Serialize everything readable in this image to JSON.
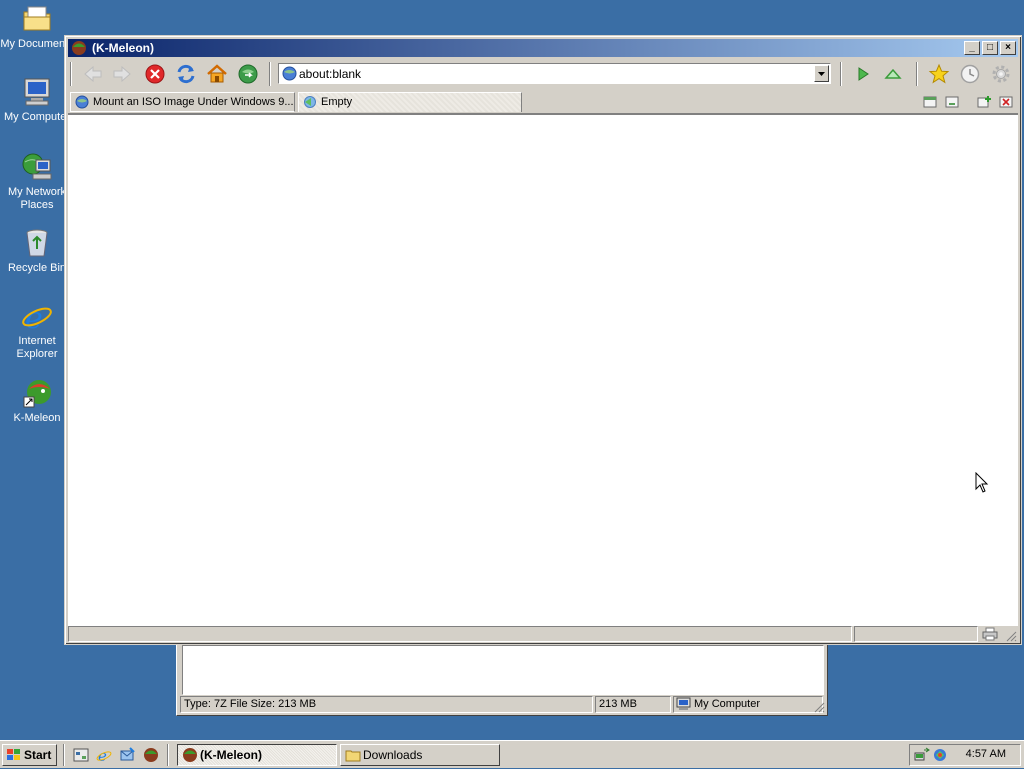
{
  "desktop": {
    "icons": [
      {
        "label": "My Documents",
        "icon": "folder-documents-icon"
      },
      {
        "label": "My Computer",
        "icon": "computer-icon"
      },
      {
        "label": "My Network Places",
        "icon": "network-places-icon"
      },
      {
        "label": "Recycle Bin",
        "icon": "recycle-bin-icon"
      },
      {
        "label": "Internet Explorer",
        "icon": "internet-explorer-icon"
      },
      {
        "label": "K-Meleon",
        "icon": "k-meleon-icon"
      }
    ]
  },
  "browser": {
    "title": "(K-Meleon)",
    "caption_buttons": {
      "minimize": "_",
      "maximize": "□",
      "close": "×"
    },
    "toolbar": {
      "buttons": [
        "back",
        "forward",
        "stop",
        "reload",
        "home",
        "go"
      ],
      "right_buttons": [
        "play",
        "up",
        "bookmarks",
        "history",
        "settings"
      ]
    },
    "url": {
      "value": "about:blank"
    },
    "tabs": [
      {
        "label": "Mount an ISO Image Under Windows 9...",
        "active": false
      },
      {
        "label": "Empty",
        "active": true
      }
    ]
  },
  "background_window": {
    "title": "Downloads",
    "status": {
      "type_info": "Type: 7Z File Size: 213 MB",
      "size": "213 MB",
      "zone": "My Computer"
    }
  },
  "taskbar": {
    "start_label": "Start",
    "tasks": [
      {
        "label": "(K-Meleon)",
        "active": true
      },
      {
        "label": "Downloads",
        "active": false
      }
    ],
    "clock": "4:57 AM"
  },
  "colors": {
    "desktop": "#3a6ea5",
    "title_start": "#0a246a",
    "title_end": "#a6caf0",
    "face": "#d4d0c8"
  }
}
